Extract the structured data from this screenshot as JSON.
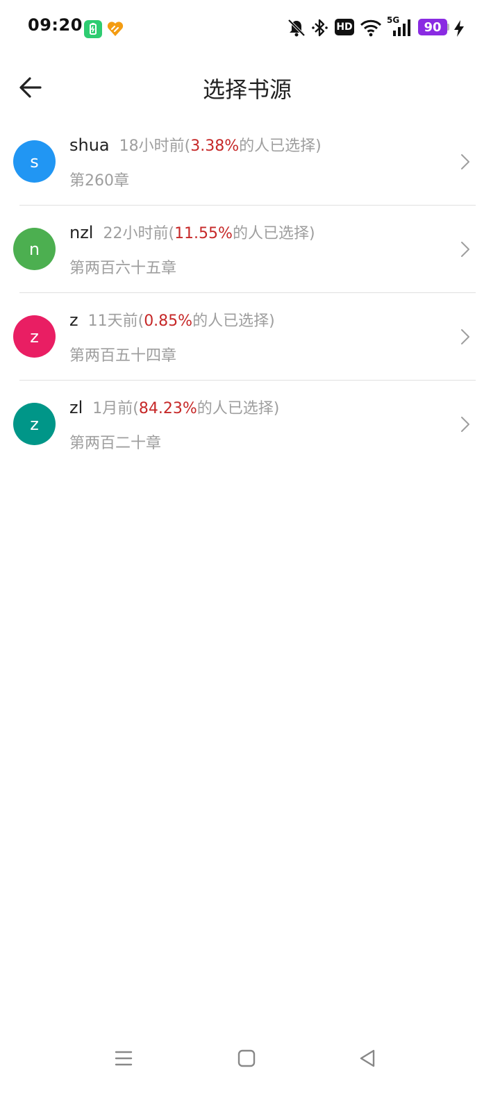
{
  "status_bar": {
    "time": "09:20",
    "battery_level": "90",
    "hd_label": "HD",
    "network_label": "5G",
    "colors": {
      "app_icon_green": "#2ecc71",
      "app_icon_orange": "#f39c12",
      "battery_purple": "#8a2be2"
    },
    "icons": [
      "battery-saver-app-icon",
      "heart-app-icon",
      "bell-off-icon",
      "bluetooth-icon",
      "hd-icon",
      "wifi-icon",
      "signal-icon",
      "battery-icon",
      "charging-icon"
    ]
  },
  "header": {
    "title": "选择书源",
    "back_icon": "arrow-left-icon"
  },
  "sources": [
    {
      "avatar_letter": "s",
      "avatar_color": "#2196f3",
      "name": "shua",
      "time_prefix": "18小时前(",
      "percent": "3.38%",
      "suffix": "的人已选择)",
      "chapter": "第260章"
    },
    {
      "avatar_letter": "n",
      "avatar_color": "#4caf50",
      "name": "nzl",
      "time_prefix": "22小时前(",
      "percent": "11.55%",
      "suffix": "的人已选择)",
      "chapter": "第两百六十五章"
    },
    {
      "avatar_letter": "z",
      "avatar_color": "#e91e63",
      "name": "z",
      "time_prefix": "11天前(",
      "percent": "0.85%",
      "suffix": "的人已选择)",
      "chapter": "第两百五十四章"
    },
    {
      "avatar_letter": "z",
      "avatar_color": "#009688",
      "name": "zl",
      "time_prefix": "1月前(",
      "percent": "84.23%",
      "suffix": "的人已选择)",
      "chapter": "第两百二十章"
    }
  ],
  "nav_bar": {
    "icons": [
      "menu-icon",
      "home-icon",
      "back-icon"
    ]
  }
}
